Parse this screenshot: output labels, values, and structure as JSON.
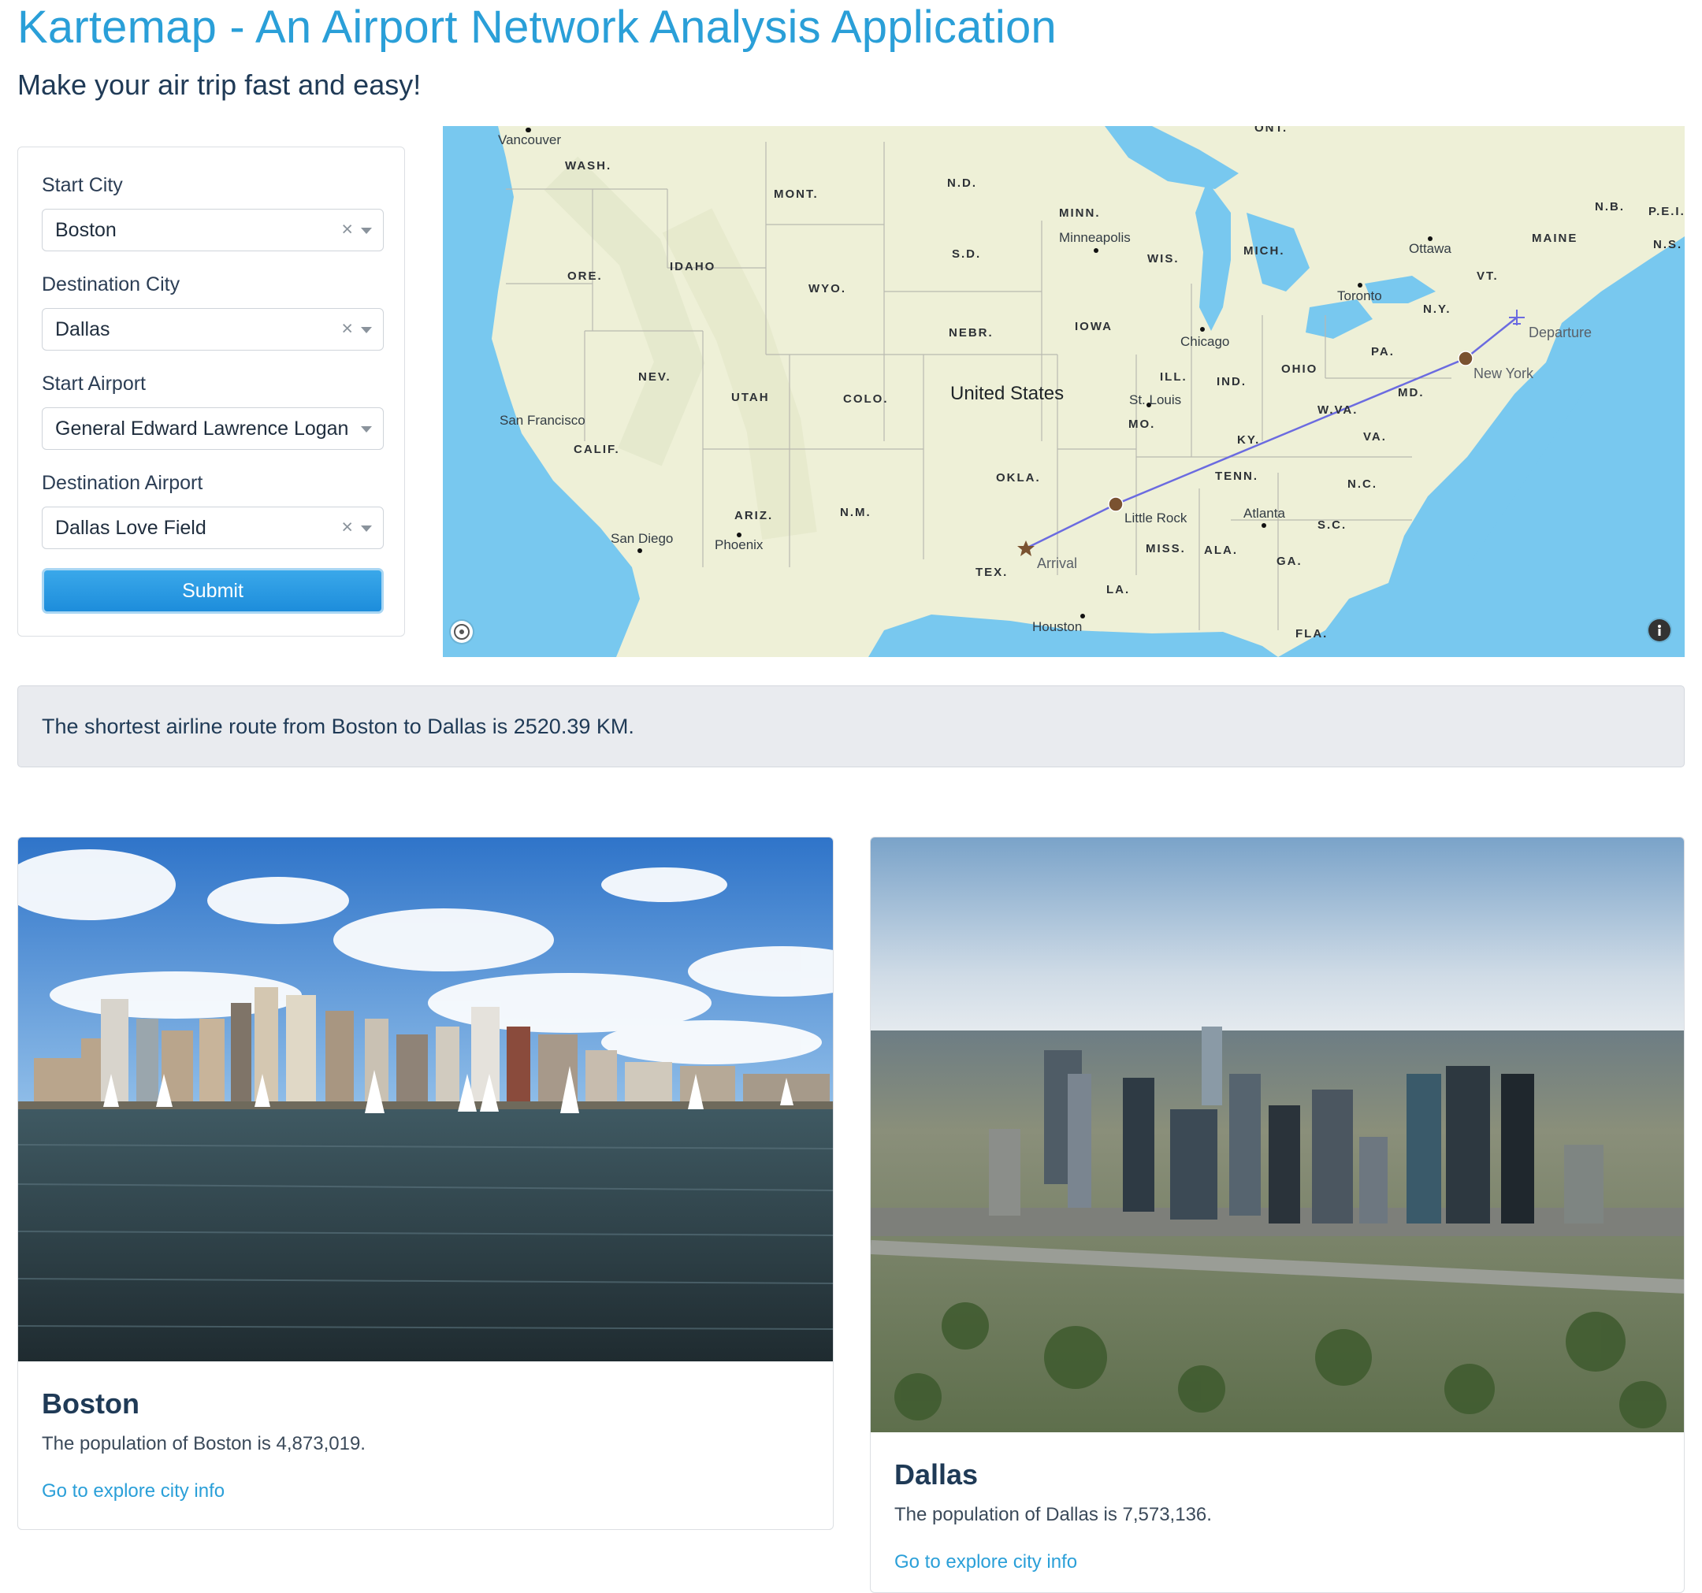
{
  "header": {
    "title": "Kartemap - An Airport Network Analysis Application",
    "subtitle": "Make your air trip fast and easy!"
  },
  "form": {
    "start_city_label": "Start City",
    "start_city_value": "Boston",
    "destination_city_label": "Destination City",
    "destination_city_value": "Dallas",
    "start_airport_label": "Start Airport",
    "start_airport_value": "General Edward Lawrence Logan I...",
    "destination_airport_label": "Destination Airport",
    "destination_airport_value": "Dallas Love Field",
    "clear_glyph": "×",
    "submit_label": "Submit"
  },
  "map": {
    "country_label": "United States",
    "cities": [
      "Vancouver",
      "Minneapolis",
      "Ottawa",
      "Toronto",
      "Chicago",
      "St. Louis",
      "San Francisco",
      "San Diego",
      "Phoenix",
      "Little Rock",
      "Atlanta",
      "Houston",
      "New York"
    ],
    "states": [
      "WASH.",
      "MONT.",
      "N.D.",
      "MINN.",
      "S.D.",
      "WIS.",
      "MICH.",
      "ORE.",
      "IDAHO",
      "WYO.",
      "NEBR.",
      "IOWA",
      "NEV.",
      "UTAH",
      "COLO.",
      "ILL.",
      "IND.",
      "OHIO",
      "PA.",
      "N.Y.",
      "VT.",
      "MAINE",
      "N.B.",
      "P.E.I.",
      "N.S.",
      "MD.",
      "W.VA.",
      "VA.",
      "KY.",
      "MO.",
      "CALIF.",
      "OKLA.",
      "TENN.",
      "N.C.",
      "ARIZ.",
      "N.M.",
      "S.C.",
      "MISS.",
      "ALA.",
      "GA.",
      "TEX.",
      "LA.",
      "FLA.",
      "ONT."
    ],
    "route_labels": {
      "departure": "Departure",
      "new_york": "New York",
      "arrival": "Arrival"
    },
    "route_color": "#6b6be0",
    "marker_color": "#7a5230",
    "controls": [
      "compass-icon",
      "info-icon"
    ]
  },
  "result": {
    "text": "The shortest airline route from Boston to Dallas is 2520.39 KM."
  },
  "cities": [
    {
      "name": "Boston",
      "population_text": "The population of Boston is 4,873,019.",
      "link_text": "Go to explore city info"
    },
    {
      "name": "Dallas",
      "population_text": "The population of Dallas is 7,573,136.",
      "link_text": "Go to explore city info"
    }
  ],
  "colors": {
    "accent": "#2a9fd8",
    "text": "#1f3a56",
    "alert_bg": "#e9ebef",
    "water": "#78c8ef",
    "land": "#eef0d7"
  }
}
